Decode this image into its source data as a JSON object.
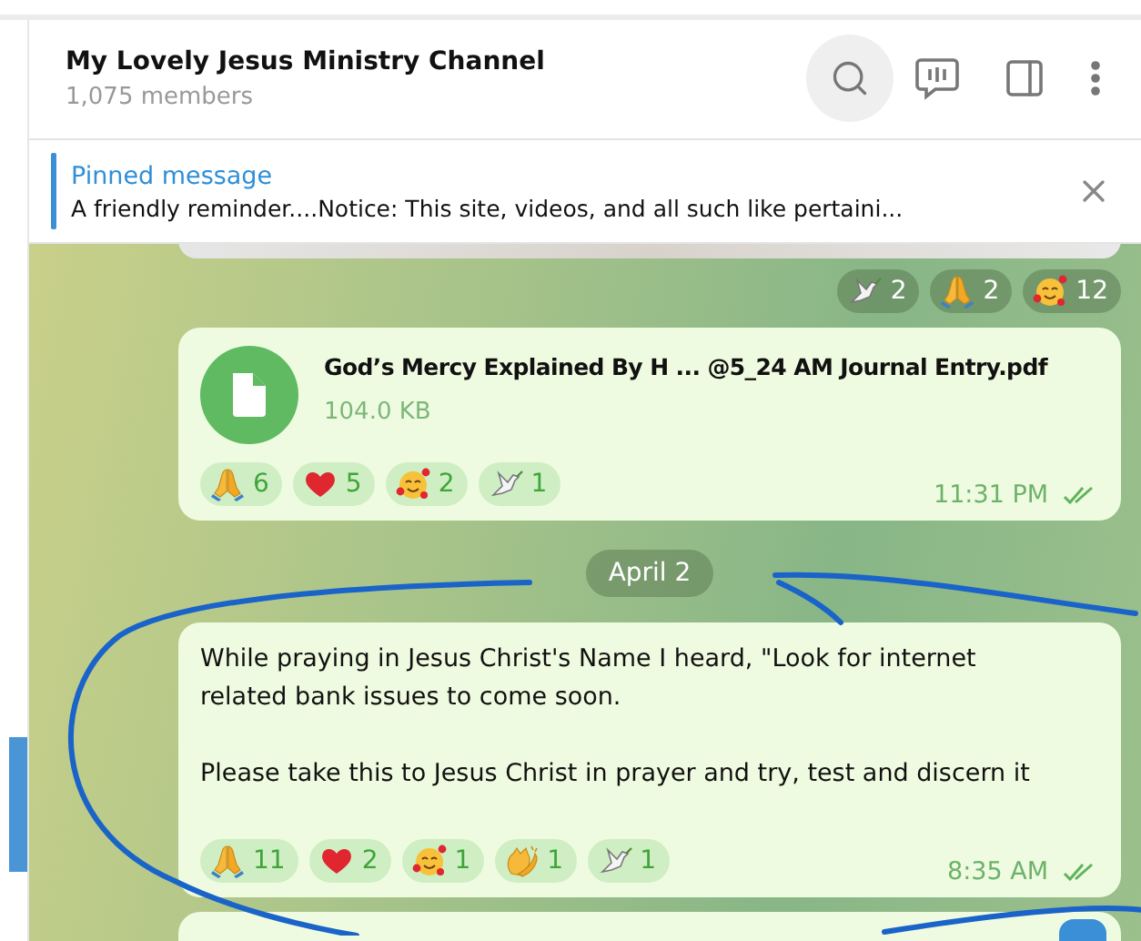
{
  "channel": {
    "title": "My Lovely Jesus Ministry Channel",
    "members": "1,075 members"
  },
  "pinned": {
    "label": "Pinned message",
    "text": "A friendly reminder....Notice: This site, videos, and all such like pertaini..."
  },
  "messages": [
    {
      "kind": "photo",
      "reactions": [
        {
          "kind": "dove",
          "count": "2"
        },
        {
          "kind": "pray",
          "count": "2"
        },
        {
          "kind": "hearts-face",
          "count": "12"
        }
      ]
    },
    {
      "kind": "file",
      "file_name": "God’s Mercy Explained By H ... @5_24 AM Journal Entry.pdf",
      "file_size": "104.0 KB",
      "reactions": [
        {
          "kind": "pray",
          "count": "6"
        },
        {
          "kind": "heart",
          "count": "5"
        },
        {
          "kind": "hearts-face",
          "count": "2"
        },
        {
          "kind": "dove",
          "count": "1"
        }
      ],
      "time": "11:31 PM",
      "read": true
    },
    {
      "kind": "date",
      "label": "April 2"
    },
    {
      "kind": "text",
      "paragraphs": [
        "While praying in Jesus Christ's Name I heard, \"Look for internet related bank issues to come soon.",
        "Please take this to Jesus Christ in prayer and try, test and discern it"
      ],
      "reactions": [
        {
          "kind": "pray",
          "count": "11"
        },
        {
          "kind": "heart",
          "count": "2"
        },
        {
          "kind": "hearts-face",
          "count": "1"
        },
        {
          "kind": "clap",
          "count": "1"
        },
        {
          "kind": "dove",
          "count": "1"
        }
      ],
      "time": "8:35 AM",
      "read": true
    },
    {
      "kind": "partial"
    }
  ]
}
